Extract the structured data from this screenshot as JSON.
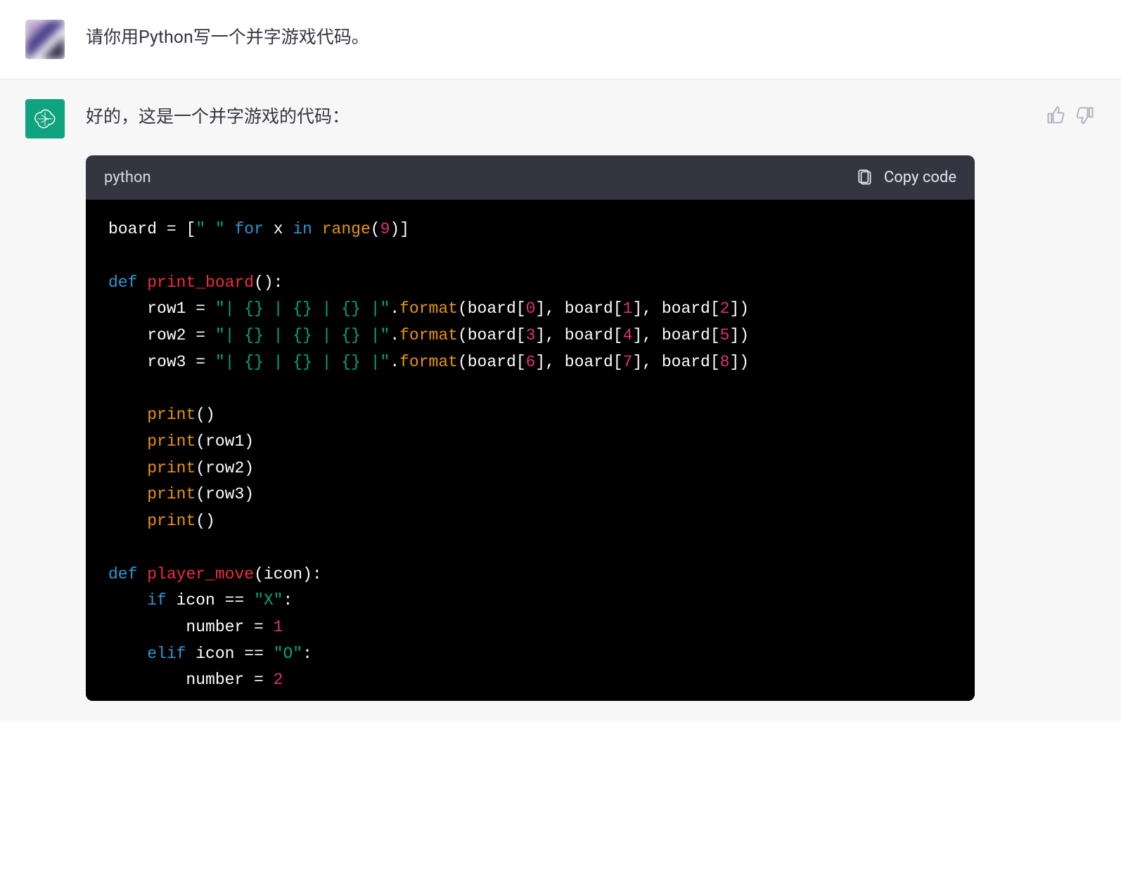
{
  "user_message": "请你用Python写一个并字游戏代码。",
  "assistant_intro": "好的，这是一个并字游戏的代码：",
  "code_header": {
    "language": "python",
    "copy_label": "Copy code"
  },
  "code": {
    "lines": [
      [
        {
          "t": "board ",
          "c": "ident"
        },
        {
          "t": "=",
          "c": "op"
        },
        {
          "t": " [",
          "c": "paren"
        },
        {
          "t": "\" \"",
          "c": "str"
        },
        {
          "t": " ",
          "c": "ident"
        },
        {
          "t": "for",
          "c": "kw"
        },
        {
          "t": " x ",
          "c": "ident"
        },
        {
          "t": "in",
          "c": "kw"
        },
        {
          "t": " ",
          "c": "ident"
        },
        {
          "t": "range",
          "c": "call"
        },
        {
          "t": "(",
          "c": "paren"
        },
        {
          "t": "9",
          "c": "num"
        },
        {
          "t": ")]",
          "c": "paren"
        }
      ],
      [],
      [
        {
          "t": "def",
          "c": "kw"
        },
        {
          "t": " ",
          "c": "ident"
        },
        {
          "t": "print_board",
          "c": "func"
        },
        {
          "t": "():",
          "c": "paren"
        }
      ],
      [
        {
          "t": "    row1 ",
          "c": "ident"
        },
        {
          "t": "=",
          "c": "op"
        },
        {
          "t": " ",
          "c": "ident"
        },
        {
          "t": "\"| {} | {} | {} |\"",
          "c": "str"
        },
        {
          "t": ".",
          "c": "op"
        },
        {
          "t": "format",
          "c": "call"
        },
        {
          "t": "(board[",
          "c": "paren"
        },
        {
          "t": "0",
          "c": "num"
        },
        {
          "t": "], board[",
          "c": "paren"
        },
        {
          "t": "1",
          "c": "num"
        },
        {
          "t": "], board[",
          "c": "paren"
        },
        {
          "t": "2",
          "c": "num"
        },
        {
          "t": "])",
          "c": "paren"
        }
      ],
      [
        {
          "t": "    row2 ",
          "c": "ident"
        },
        {
          "t": "=",
          "c": "op"
        },
        {
          "t": " ",
          "c": "ident"
        },
        {
          "t": "\"| {} | {} | {} |\"",
          "c": "str"
        },
        {
          "t": ".",
          "c": "op"
        },
        {
          "t": "format",
          "c": "call"
        },
        {
          "t": "(board[",
          "c": "paren"
        },
        {
          "t": "3",
          "c": "num"
        },
        {
          "t": "], board[",
          "c": "paren"
        },
        {
          "t": "4",
          "c": "num"
        },
        {
          "t": "], board[",
          "c": "paren"
        },
        {
          "t": "5",
          "c": "num"
        },
        {
          "t": "])",
          "c": "paren"
        }
      ],
      [
        {
          "t": "    row3 ",
          "c": "ident"
        },
        {
          "t": "=",
          "c": "op"
        },
        {
          "t": " ",
          "c": "ident"
        },
        {
          "t": "\"| {} | {} | {} |\"",
          "c": "str"
        },
        {
          "t": ".",
          "c": "op"
        },
        {
          "t": "format",
          "c": "call"
        },
        {
          "t": "(board[",
          "c": "paren"
        },
        {
          "t": "6",
          "c": "num"
        },
        {
          "t": "], board[",
          "c": "paren"
        },
        {
          "t": "7",
          "c": "num"
        },
        {
          "t": "], board[",
          "c": "paren"
        },
        {
          "t": "8",
          "c": "num"
        },
        {
          "t": "])",
          "c": "paren"
        }
      ],
      [],
      [
        {
          "t": "    ",
          "c": "ident"
        },
        {
          "t": "print",
          "c": "call"
        },
        {
          "t": "()",
          "c": "paren"
        }
      ],
      [
        {
          "t": "    ",
          "c": "ident"
        },
        {
          "t": "print",
          "c": "call"
        },
        {
          "t": "(row1)",
          "c": "paren"
        }
      ],
      [
        {
          "t": "    ",
          "c": "ident"
        },
        {
          "t": "print",
          "c": "call"
        },
        {
          "t": "(row2)",
          "c": "paren"
        }
      ],
      [
        {
          "t": "    ",
          "c": "ident"
        },
        {
          "t": "print",
          "c": "call"
        },
        {
          "t": "(row3)",
          "c": "paren"
        }
      ],
      [
        {
          "t": "    ",
          "c": "ident"
        },
        {
          "t": "print",
          "c": "call"
        },
        {
          "t": "()",
          "c": "paren"
        }
      ],
      [],
      [
        {
          "t": "def",
          "c": "kw"
        },
        {
          "t": " ",
          "c": "ident"
        },
        {
          "t": "player_move",
          "c": "func"
        },
        {
          "t": "(icon):",
          "c": "paren"
        }
      ],
      [
        {
          "t": "    ",
          "c": "ident"
        },
        {
          "t": "if",
          "c": "kw"
        },
        {
          "t": " icon ",
          "c": "ident"
        },
        {
          "t": "==",
          "c": "op"
        },
        {
          "t": " ",
          "c": "ident"
        },
        {
          "t": "\"X\"",
          "c": "str"
        },
        {
          "t": ":",
          "c": "paren"
        }
      ],
      [
        {
          "t": "        number ",
          "c": "ident"
        },
        {
          "t": "=",
          "c": "op"
        },
        {
          "t": " ",
          "c": "ident"
        },
        {
          "t": "1",
          "c": "num"
        }
      ],
      [
        {
          "t": "    ",
          "c": "ident"
        },
        {
          "t": "elif",
          "c": "kw"
        },
        {
          "t": " icon ",
          "c": "ident"
        },
        {
          "t": "==",
          "c": "op"
        },
        {
          "t": " ",
          "c": "ident"
        },
        {
          "t": "\"O\"",
          "c": "str"
        },
        {
          "t": ":",
          "c": "paren"
        }
      ],
      [
        {
          "t": "        number ",
          "c": "ident"
        },
        {
          "t": "=",
          "c": "op"
        },
        {
          "t": " ",
          "c": "ident"
        },
        {
          "t": "2",
          "c": "num"
        }
      ]
    ]
  }
}
